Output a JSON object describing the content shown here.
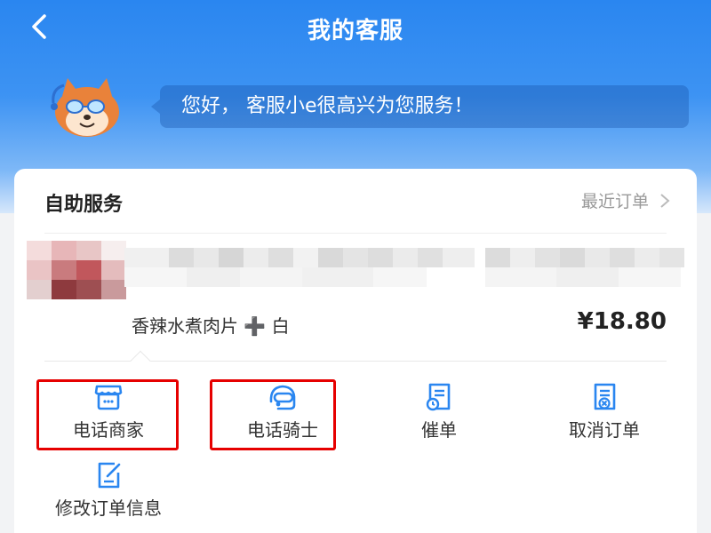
{
  "nav": {
    "title": "我的客服",
    "back_icon": "chevron-left-icon"
  },
  "greeting": {
    "mascot_icon": "shiba-mascot-icon",
    "message": "您好， 客服小e很高兴为您服务！"
  },
  "self_service": {
    "title": "自助服务",
    "recent_orders_label": "最近订单",
    "recent_orders_icon": "chevron-right-icon"
  },
  "order": {
    "dish_name": "香辣水煮肉片 ➕ 白",
    "price": "¥18.80",
    "thumbnail_blurred": true,
    "merchant_name_blurred": true
  },
  "actions": [
    {
      "label": "电话商家",
      "icon": "store-icon",
      "highlighted": true
    },
    {
      "label": "电话骑士",
      "icon": "helmet-icon",
      "highlighted": true
    },
    {
      "label": "催单",
      "icon": "clock-document-icon",
      "highlighted": false
    },
    {
      "label": "取消订单",
      "icon": "cancel-document-icon",
      "highlighted": false
    },
    {
      "label": "修改订单信息",
      "icon": "edit-document-icon",
      "highlighted": false
    }
  ],
  "colors": {
    "header_blue": "#2a86f0",
    "icon_blue": "#2a86f0",
    "highlight_red": "#e60000",
    "price_text": "#222222"
  }
}
